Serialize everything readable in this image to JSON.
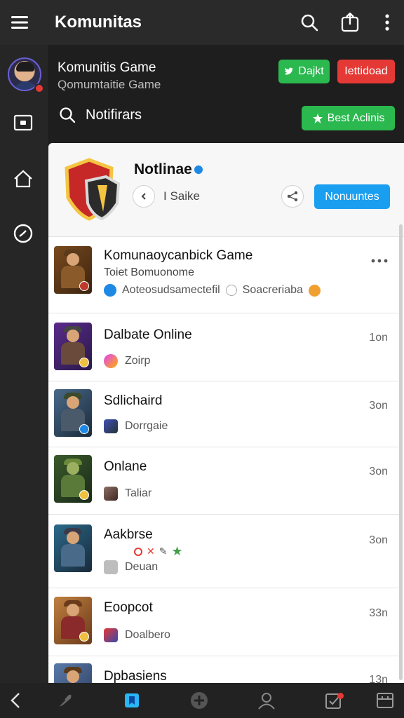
{
  "topbar": {
    "title": "Komunitas",
    "icons": [
      "menu-icon",
      "search-icon",
      "share-icon",
      "more-vertical-icon"
    ]
  },
  "community": {
    "name": "Komunitis Game",
    "subtitle": "Qomumtaitie Game",
    "btn_green": "Dajkt",
    "btn_red": "Iettidoad",
    "search_label": "Notifirars",
    "btn_admins": "Best Aclinis",
    "colors": {
      "green": "#2bb84f",
      "red": "#e53935",
      "blue": "#1a9ef0"
    }
  },
  "card": {
    "title": "Notlinae",
    "pill_label": "I Saike",
    "notify_label": "Nonuuntes"
  },
  "items": [
    {
      "title": "Komunaoycanbick Game",
      "line2": "Toiet Bomuonome",
      "sub_a": "Aoteosudsamectefil",
      "sub_b": "Soacreriaba",
      "time": ""
    },
    {
      "title": "Dalbate Online",
      "sub": "Zoirp",
      "time": "1on"
    },
    {
      "title": "Sdlichaird",
      "sub": "Dorrgaie",
      "time": "3on"
    },
    {
      "title": "Onlane",
      "sub": "Taliar",
      "time": "3on"
    },
    {
      "title": "Aakbrse",
      "sub": "Deuan",
      "time": "3on"
    },
    {
      "title": "Eoopcot",
      "sub": "Doalbero",
      "time": "33n"
    },
    {
      "title": "Dpbasiens",
      "sub": "",
      "time": "13n"
    }
  ],
  "bottom_nav": [
    "back-icon",
    "feather-icon",
    "bookmark-icon",
    "add-icon",
    "profile-icon",
    "tasks-icon",
    "inbox-icon"
  ]
}
